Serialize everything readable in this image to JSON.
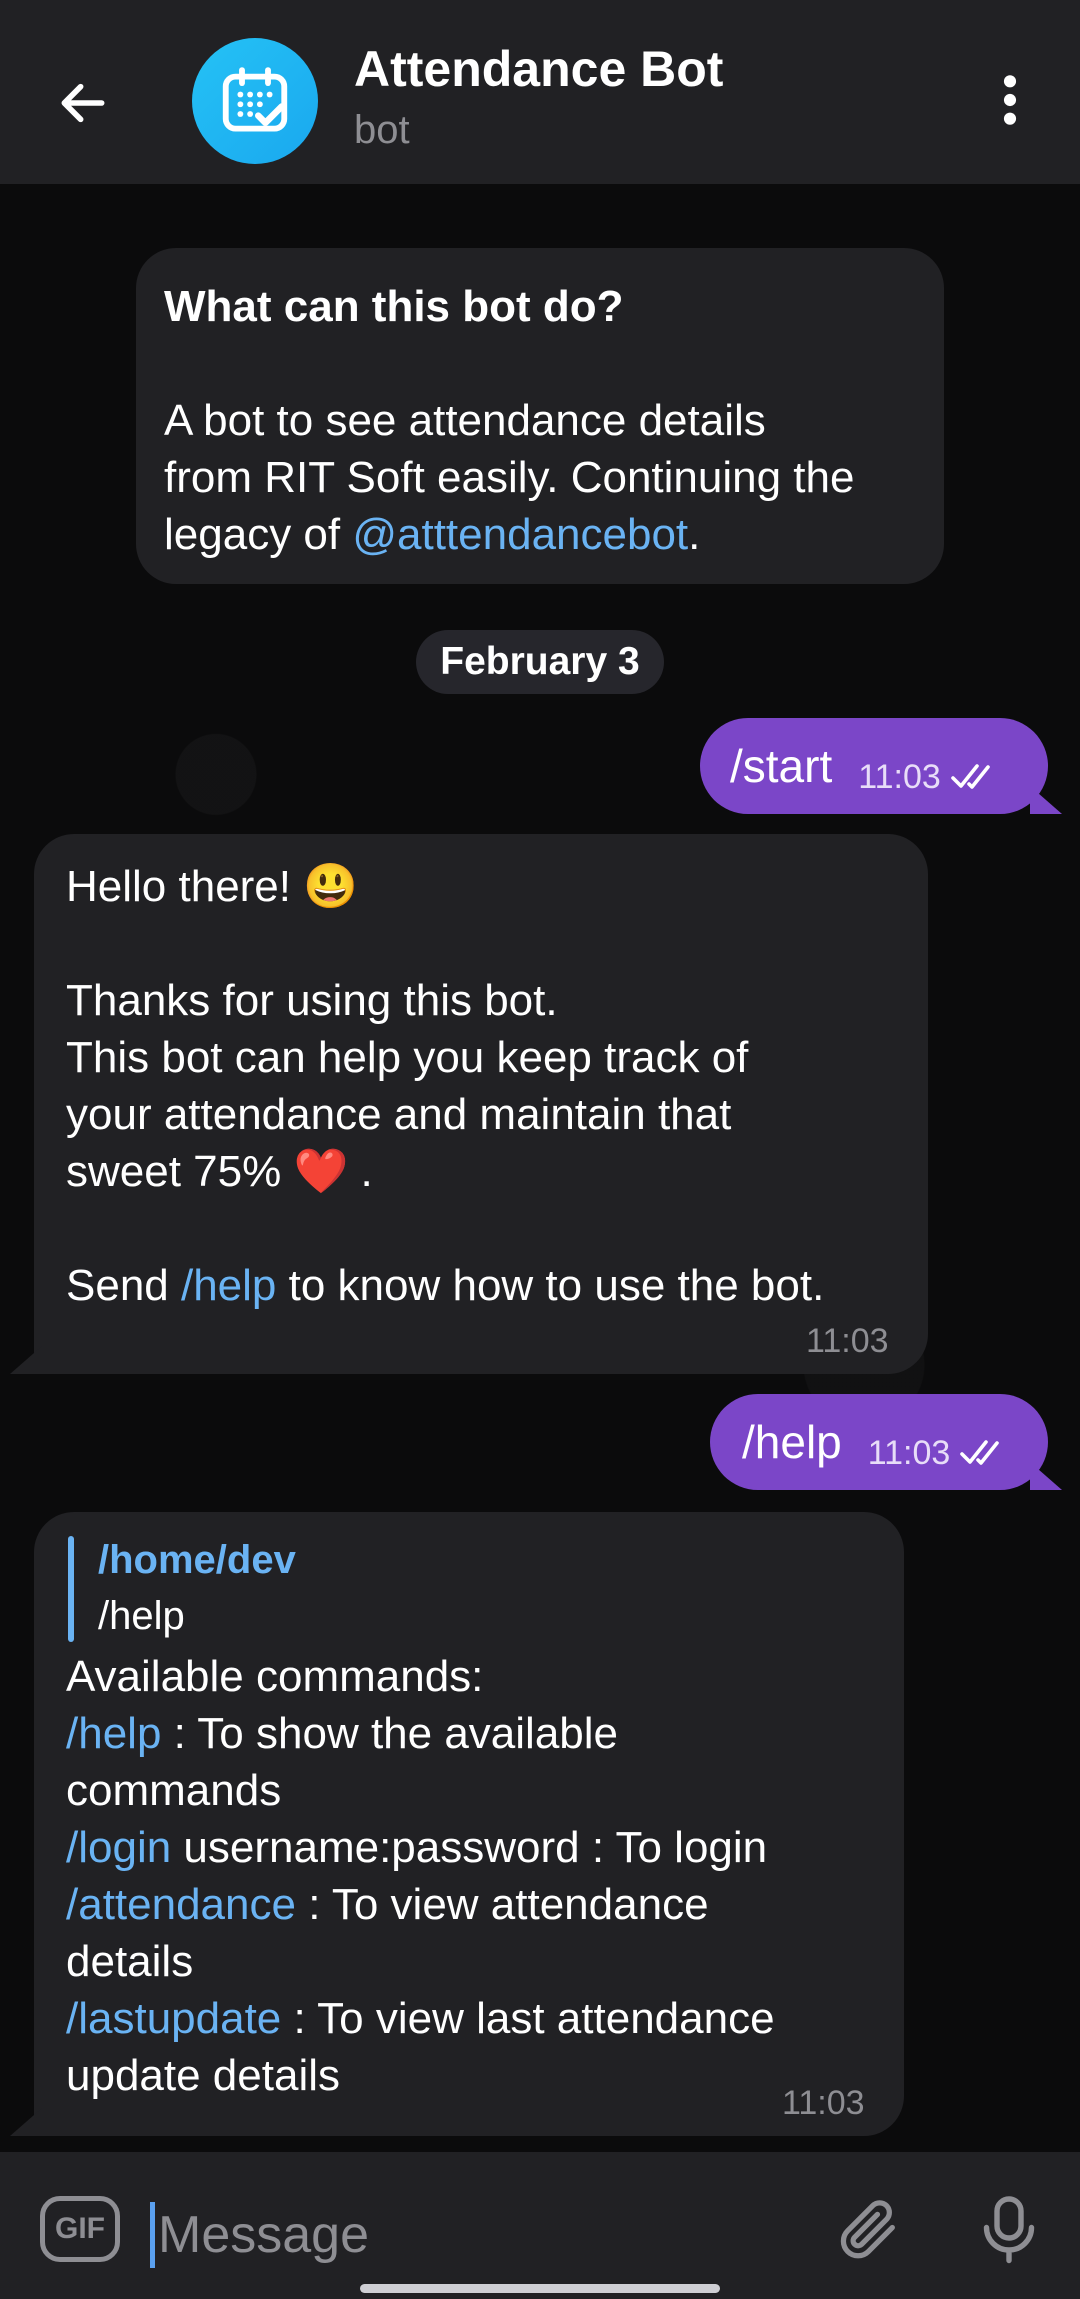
{
  "header": {
    "title": "Attendance Bot",
    "subtitle": "bot",
    "avatar_icon": "calendar-check-icon",
    "accent": "#1fb4f2"
  },
  "info_card": {
    "heading": "What can this bot do?",
    "line1": "A bot to see attendance details",
    "line2": "from RIT Soft easily. Continuing the",
    "line3_prefix": "legacy of ",
    "line3_link": "@atttendancebot",
    "line3_suffix": "."
  },
  "date_pill": "February 3",
  "messages": {
    "start": {
      "text": "/start",
      "time": "11:03"
    },
    "hello": {
      "line1": "Hello there! 😃",
      "line2": "Thanks for using this bot.",
      "line3": "This bot can help you keep track of",
      "line4": "your attendance and maintain that",
      "line5": "sweet 75% ❤️ .",
      "line6_prefix": "Send ",
      "line6_link": "/help",
      "line6_suffix": " to know how to use the bot.",
      "time": "11:03"
    },
    "help": {
      "text": "/help",
      "time": "11:03"
    },
    "commands": {
      "reply_author": "/home/dev",
      "reply_text": "/help",
      "intro": "Available commands:",
      "help_cmd": "/help",
      "help_desc1": " : To show the available",
      "help_desc2": "commands",
      "login_cmd": "/login",
      "login_desc": " username:password : To login",
      "attendance_cmd": "/attendance",
      "attendance_desc1": " : To view attendance",
      "attendance_desc2": "details",
      "lastupdate_cmd": "/lastupdate",
      "lastupdate_desc1": " : To view last attendance",
      "lastupdate_desc2": "update details",
      "time": "11:03"
    }
  },
  "input": {
    "gif_label": "GIF",
    "placeholder": "Message"
  },
  "colors": {
    "outgoing_bubble": "#7b46c8",
    "incoming_bubble": "#212124",
    "link": "#6ab3f3"
  }
}
